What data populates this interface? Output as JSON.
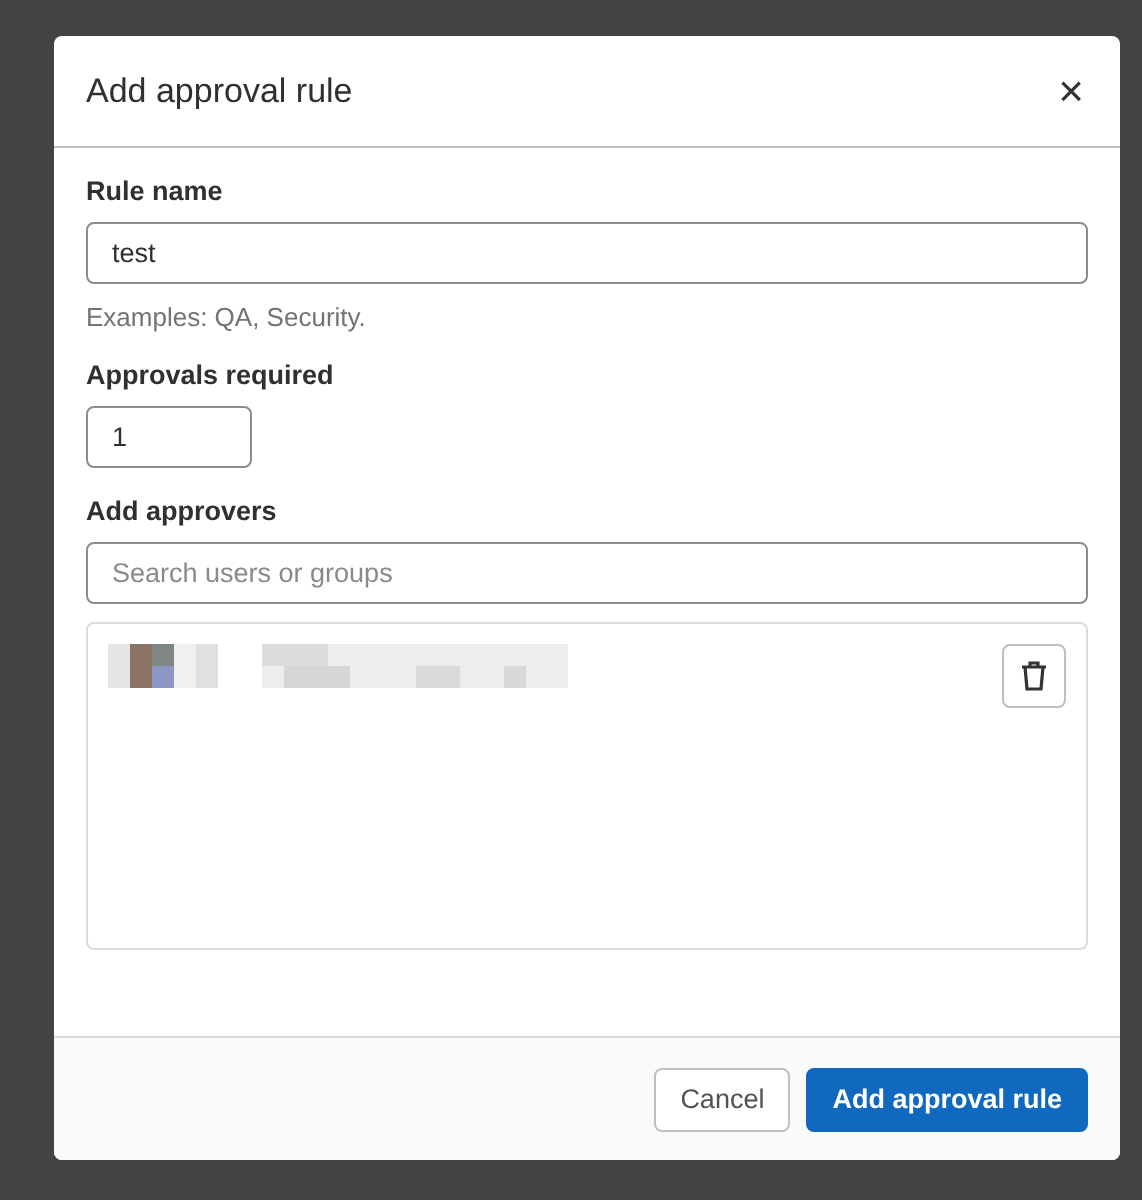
{
  "modal": {
    "title": "Add approval rule",
    "close": "×"
  },
  "fields": [
    {
      "kind": "text",
      "label": "Rule name",
      "value": "test",
      "help": "Examples: QA, Security."
    },
    {
      "kind": "number",
      "label": "Approvals required",
      "value": "1"
    },
    {
      "kind": "search",
      "label": "Add approvers",
      "placeholder": "Search users or groups"
    }
  ],
  "buttons": [
    {
      "label": "Cancel",
      "kind": "secondary"
    },
    {
      "label": "Add approval rule",
      "kind": "primary"
    }
  ]
}
